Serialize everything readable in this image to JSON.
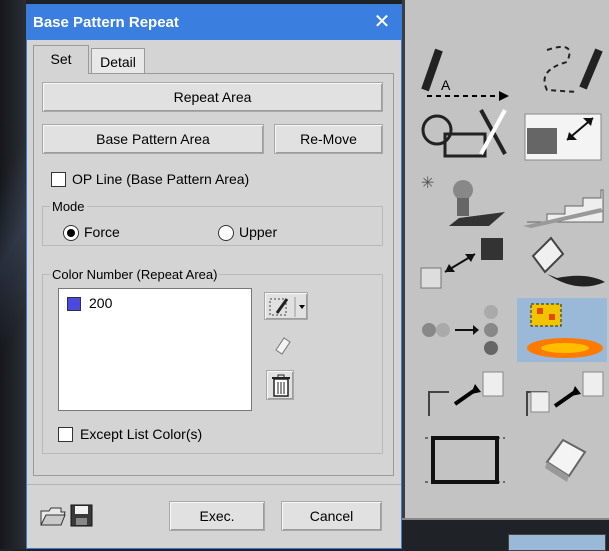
{
  "window": {
    "title": "Base Pattern Repeat",
    "close_glyph": "✕"
  },
  "tabs": [
    {
      "label": "Set",
      "active": true
    },
    {
      "label": "Detail",
      "active": false
    }
  ],
  "buttons": {
    "repeat_area": "Repeat Area",
    "base_pattern_area": "Base Pattern Area",
    "re_move": "Re-Move",
    "exec": "Exec.",
    "cancel": "Cancel"
  },
  "op_line": {
    "label": "OP Line (Base Pattern Area)",
    "checked": false
  },
  "mode": {
    "label": "Mode",
    "options": [
      {
        "label": "Force",
        "selected": true
      },
      {
        "label": "Upper",
        "selected": false
      }
    ]
  },
  "color_number": {
    "label": "Color Number (Repeat Area)",
    "items": [
      {
        "value": "200",
        "color": "#4a4ae0"
      }
    ]
  },
  "except_list": {
    "label": "Except List Color(s)",
    "checked": false
  },
  "icons": {
    "edit_color": "pencil-dropdown-icon",
    "eraser": "eraser-icon",
    "delete": "trash-icon",
    "open": "open-folder-icon",
    "save": "floppy-disk-icon"
  },
  "colors": {
    "titlebar": "#3a7fe0",
    "dialog_bg": "#d4d4d4",
    "selected_tool": "#9ab8d8"
  }
}
